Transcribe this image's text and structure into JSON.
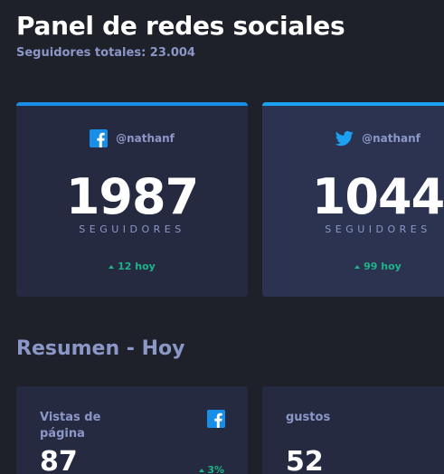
{
  "header": {
    "title": "Panel de redes sociales",
    "subtitle": "Seguidores totales: 23.004"
  },
  "cards": [
    {
      "network": "facebook",
      "icon": "facebook-icon",
      "handle": "@nathanf",
      "count": "1987",
      "label": "SEGUIDORES",
      "delta": "12 hoy"
    },
    {
      "network": "twitter",
      "icon": "twitter-icon",
      "handle": "@nathanf",
      "count": "1044",
      "label": "SEGUIDORES",
      "delta": "99 hoy"
    }
  ],
  "overview": {
    "title": "Resumen - Hoy",
    "items": [
      {
        "title": "Vistas de página",
        "icon": "facebook-icon",
        "value": "87",
        "delta": "3%"
      },
      {
        "title": "gustos",
        "value": "52"
      }
    ]
  },
  "colors": {
    "background": "#1e202a",
    "card": "#252a41",
    "muted_text": "#8b97c6",
    "positive": "#1db489",
    "facebook": "#178fe8",
    "twitter": "#1ca0f2"
  }
}
